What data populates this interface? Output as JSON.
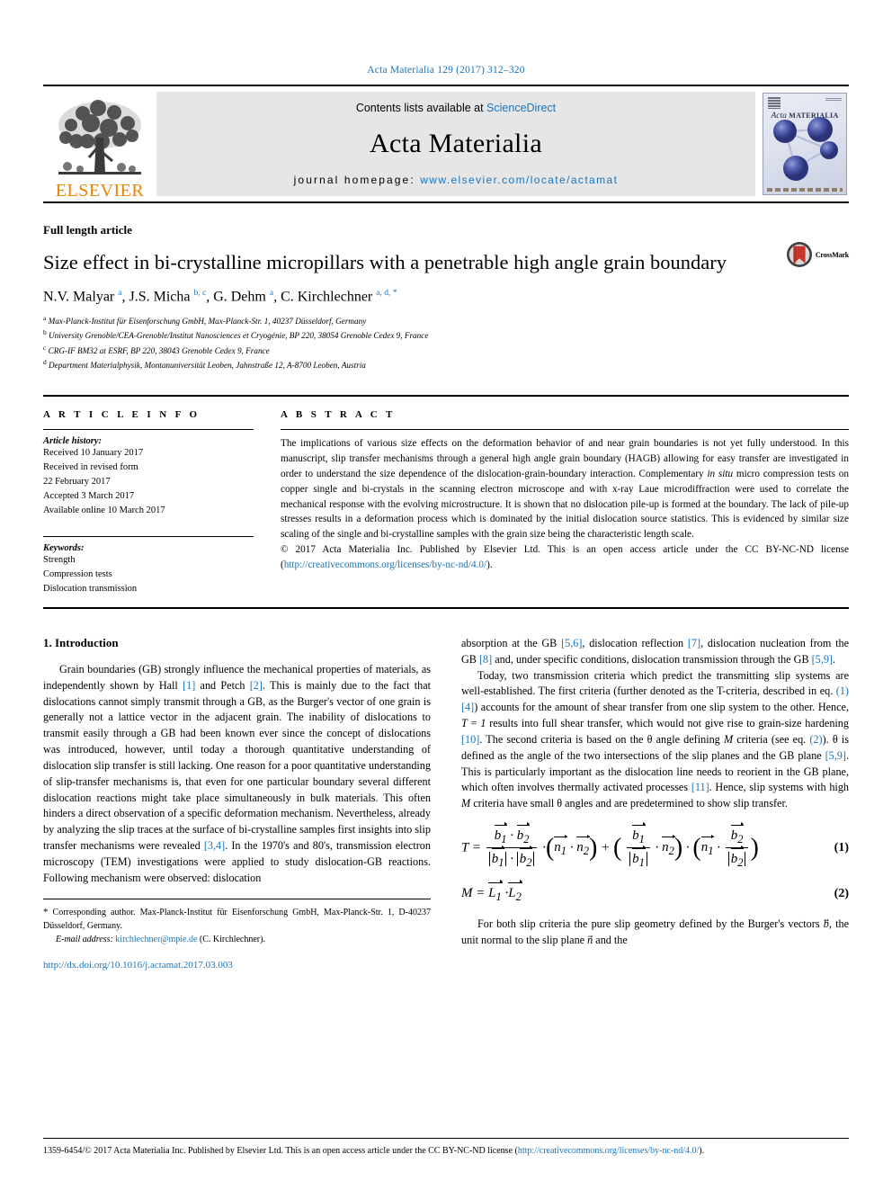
{
  "running_head": "Acta Materialia 129 (2017) 312–320",
  "masthead": {
    "publisher_name": "ELSEVIER",
    "contents_prefix": "Contents lists available at ",
    "contents_link": "ScienceDirect",
    "journal_title": "Acta Materialia",
    "homepage_prefix": "journal homepage: ",
    "homepage_url": "www.elsevier.com/locate/actamat",
    "cover_title_italic": "Acta",
    "cover_title_small": "MATERIALIA"
  },
  "article": {
    "type": "Full length article",
    "title": "Size effect in bi-crystalline micropillars with a penetrable high angle grain boundary",
    "crossmark_label": "CrossMark",
    "authors_html": "N.V. Malyar <sup>a</sup>, J.S. Micha <sup>b, c</sup>, G. Dehm <sup>a</sup>, C. Kirchlechner <sup>a, d, *</sup>",
    "affiliations": [
      {
        "marker": "a",
        "text": "Max-Planck-Institut für Eisenforschung GmbH, Max-Planck-Str. 1, 40237 Düsseldorf, Germany"
      },
      {
        "marker": "b",
        "text": "University Grenoble/CEA-Grenoble/Institut Nanosciences et Cryogénie, BP 220, 38054 Grenoble Cedex 9, France"
      },
      {
        "marker": "c",
        "text": "CRG-IF BM32 at ESRF, BP 220, 38043 Grenoble Cedex 9, France"
      },
      {
        "marker": "d",
        "text": "Department Materialphysik, Montanuniversität Leoben, Jahnstraße 12, A-8700 Leoben, Austria"
      }
    ]
  },
  "article_info": {
    "heading": "A R T I C L E  I N F O",
    "history_label": "Article history:",
    "history": [
      "Received 10 January 2017",
      "Received in revised form",
      "22 February 2017",
      "Accepted 3 March 2017",
      "Available online 10 March 2017"
    ],
    "keywords_label": "Keywords:",
    "keywords": [
      "Strength",
      "Compression tests",
      "Dislocation transmission"
    ]
  },
  "abstract": {
    "heading": "A B S T R A C T",
    "body_part1": "The implications of various size effects on the deformation behavior of and near grain boundaries is not yet fully understood. In this manuscript, slip transfer mechanisms through a general high angle grain boundary (HAGB) allowing for easy transfer are investigated in order to understand the size dependence of the dislocation-grain-boundary interaction. Complementary ",
    "in_situ": "in situ",
    "body_part2": " micro compression tests on copper single and bi-crystals in the scanning electron microscope and with x-ray Laue microdiffraction were used to correlate the mechanical response with the evolving microstructure. It is shown that no dislocation pile-up is formed at the boundary. The lack of pile-up stresses results in a deformation process which is dominated by the initial dislocation source statistics. This is evidenced by similar size scaling of the single and bi-crystalline samples with the grain size being the characteristic length scale.",
    "copyright": "© 2017 Acta Materialia Inc. Published by Elsevier Ltd. This is an open access article under the CC BY-NC-ND license (",
    "license_url": "http://creativecommons.org/licenses/by-nc-nd/4.0/",
    "copyright_tail": ")."
  },
  "body": {
    "section_number_title": "1. Introduction",
    "left_paragraphs": [
      "Grain boundaries (GB) strongly influence the mechanical properties of materials, as independently shown by Hall [1] and Petch [2]. This is mainly due to the fact that dislocations cannot simply transmit through a GB, as the Burger's vector of one grain is generally not a lattice vector in the adjacent grain. The inability of dislocations to transmit easily through a GB had been known ever since the concept of dislocations was introduced, however, until today a thorough quantitative understanding of dislocation slip transfer is still lacking. One reason for a poor quantitative understanding of slip-transfer mechanisms is, that even for one particular boundary several different dislocation reactions might take place simultaneously in bulk materials. This often hinders a direct observation of a specific deformation mechanism. Nevertheless, already by analyzing the slip traces at the surface of bi-crystalline samples first insights into slip transfer mechanisms were revealed [3,4]. In the 1970's and 80's, transmission electron microscopy (TEM) investigations were applied to study dislocation-GB reactions. Following mechanism were observed: dislocation"
    ],
    "right_paragraph_1": "absorption at the GB [5,6], dislocation reflection [7], dislocation nucleation from the GB [8] and, under specific conditions, dislocation transmission through the GB [5,9].",
    "right_paragraph_2": "Today, two transmission criteria which predict the transmitting slip systems are well-established. The first criteria (further denoted as the T-criteria, described in eq. (1) [4]) accounts for the amount of shear transfer from one slip system to the other. Hence, T = 1 results into full shear transfer, which would not give rise to grain-size hardening [10]. The second criteria is based on the θ angle defining M criteria (see eq. (2)). θ is defined as the angle of the two intersections of the slip planes and the GB plane [5,9]. This is particularly important as the dislocation line needs to reorient in the GB plane, which often involves thermally activated processes [11]. Hence, slip systems with high M criteria have small θ angles and are predetermined to show slip transfer.",
    "right_paragraph_3": "For both slip criteria the pure slip geometry defined by the Burger's vectors b, the unit normal to the slip plane n and the",
    "equation_1_number": "(1)",
    "equation_2_number": "(2)",
    "equation_1_symbols": {
      "lhs": "T",
      "b1": "b₁",
      "b2": "b₂",
      "n1": "n₁",
      "n2": "n₂"
    },
    "equation_2_symbols": {
      "lhs": "M",
      "l1": "L₁",
      "l2": "L₂"
    }
  },
  "footnote": {
    "star": "*",
    "corresponding": " Corresponding author. Max-Planck-Institut für Eisenforschung GmbH, Max-Planck-Str. 1, D-40237 Düsseldorf, Germany.",
    "email_label": "E-mail address:",
    "email": "kirchlechner@mpie.de",
    "email_owner": " (C. Kirchlechner).",
    "doi": "http://dx.doi.org/10.1016/j.actamat.2017.03.003"
  },
  "page_bottom": {
    "issn_copyright": "1359-6454/© 2017 Acta Materialia Inc. Published by Elsevier Ltd. This is an open access article under the CC BY-NC-ND license (",
    "license_url": "http://creativecommons.org/licenses/by-nc-nd/4.0/",
    "tail": ")."
  },
  "colors": {
    "link": "#1b75bb",
    "elsevier_orange": "#ef8200",
    "band_gray": "#e6e6e6",
    "crossmark_red": "#c8372d"
  }
}
